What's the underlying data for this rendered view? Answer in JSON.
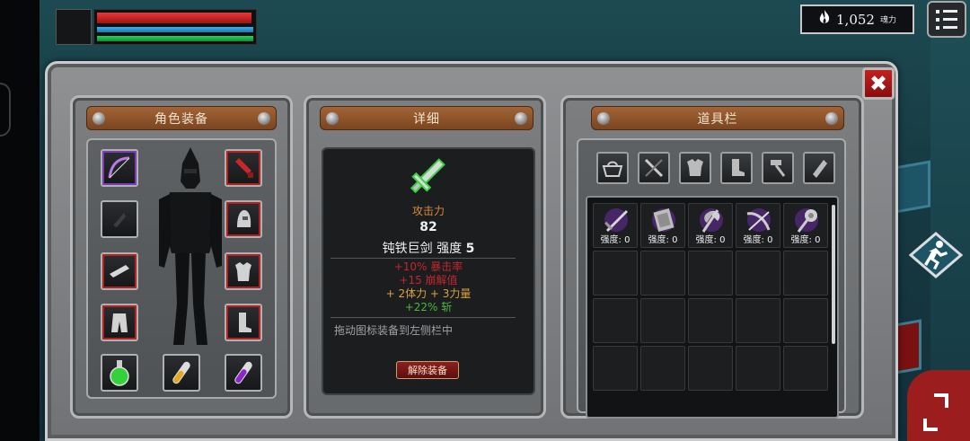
{
  "hud": {
    "soul_value": "1,052",
    "soul_label": "魂力",
    "icons": [
      "flame-icon",
      "menu-icon"
    ]
  },
  "equipment": {
    "title": "角色装备",
    "slots": [
      {
        "name": "bow-slot",
        "icon": "bow-icon"
      },
      {
        "name": "red-item-slot",
        "icon": "red-item-icon"
      },
      {
        "name": "charm-slot",
        "icon": "charm-icon"
      },
      {
        "name": "helmet-slot",
        "icon": "helmet-icon"
      },
      {
        "name": "gloves-slot",
        "icon": "gloves-icon"
      },
      {
        "name": "armor-slot",
        "icon": "armor-icon"
      },
      {
        "name": "pants-slot",
        "icon": "pants-icon"
      },
      {
        "name": "boots-slot",
        "icon": "boots-icon"
      },
      {
        "name": "green-potion-slot",
        "icon": "green-potion-icon"
      },
      {
        "name": "yellow-vial-slot",
        "icon": "yellow-vial-icon"
      },
      {
        "name": "purple-vial-slot",
        "icon": "purple-vial-icon"
      }
    ]
  },
  "detail": {
    "title": "详细",
    "attack_label": "攻击力",
    "attack_value": "82",
    "item_name": "钝铁巨剑",
    "strength_label": "强度",
    "strength_value": "5",
    "bonuses": [
      "+10% 暴击率",
      "+15 崩解值",
      "+ 2体力 + 3力量",
      "+22% 斩"
    ],
    "hint": "拖动图标装备到左侧栏中",
    "unequip_label": "解除装备"
  },
  "inventory": {
    "title": "道具栏",
    "filters": [
      "basket-icon",
      "sword-filter-icon",
      "armor-filter-icon",
      "boot-filter-icon",
      "hammer-filter-icon",
      "scroll-filter-icon"
    ],
    "items": [
      {
        "icon": "sword-icon",
        "strength": "强度: 0"
      },
      {
        "icon": "tome-icon",
        "strength": "强度: 0"
      },
      {
        "icon": "axe-icon",
        "strength": "强度: 0"
      },
      {
        "icon": "crossbow-icon",
        "strength": "强度: 0"
      },
      {
        "icon": "mace-icon",
        "strength": "强度: 0"
      }
    ]
  },
  "colors": {
    "hp": "#c21f1f",
    "mp": "#2a93cc",
    "xp": "#1fae46",
    "rare": "#7b3ab8",
    "accent_wood": "#8d5128"
  }
}
